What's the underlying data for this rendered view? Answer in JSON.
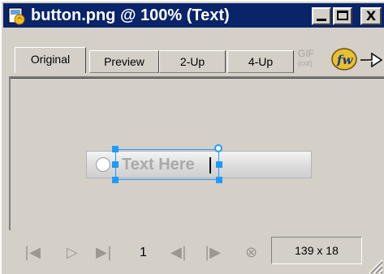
{
  "window": {
    "title": "button.png @ 100% (Text)",
    "controls": {
      "minimize": "minimize",
      "maximize": "maximize",
      "close": "X"
    }
  },
  "tabs": [
    {
      "label": "Original",
      "active": true
    },
    {
      "label": "Preview",
      "active": false
    },
    {
      "label": "2-Up",
      "active": false
    },
    {
      "label": "4-Up",
      "active": false
    }
  ],
  "format": {
    "label": "GIF",
    "sub": "(cut)"
  },
  "canvas": {
    "button_text": "Text Here",
    "selection_color": "#1e9bff"
  },
  "statusbar": {
    "page": "1",
    "size": "139 x 18",
    "icons": [
      "first-frame-icon",
      "play-icon",
      "last-frame-icon",
      "prev-frame-icon",
      "next-frame-icon",
      "stop-icon"
    ]
  },
  "colors": {
    "titlebar": "#0a246a",
    "chrome": "#d4d0c8"
  }
}
